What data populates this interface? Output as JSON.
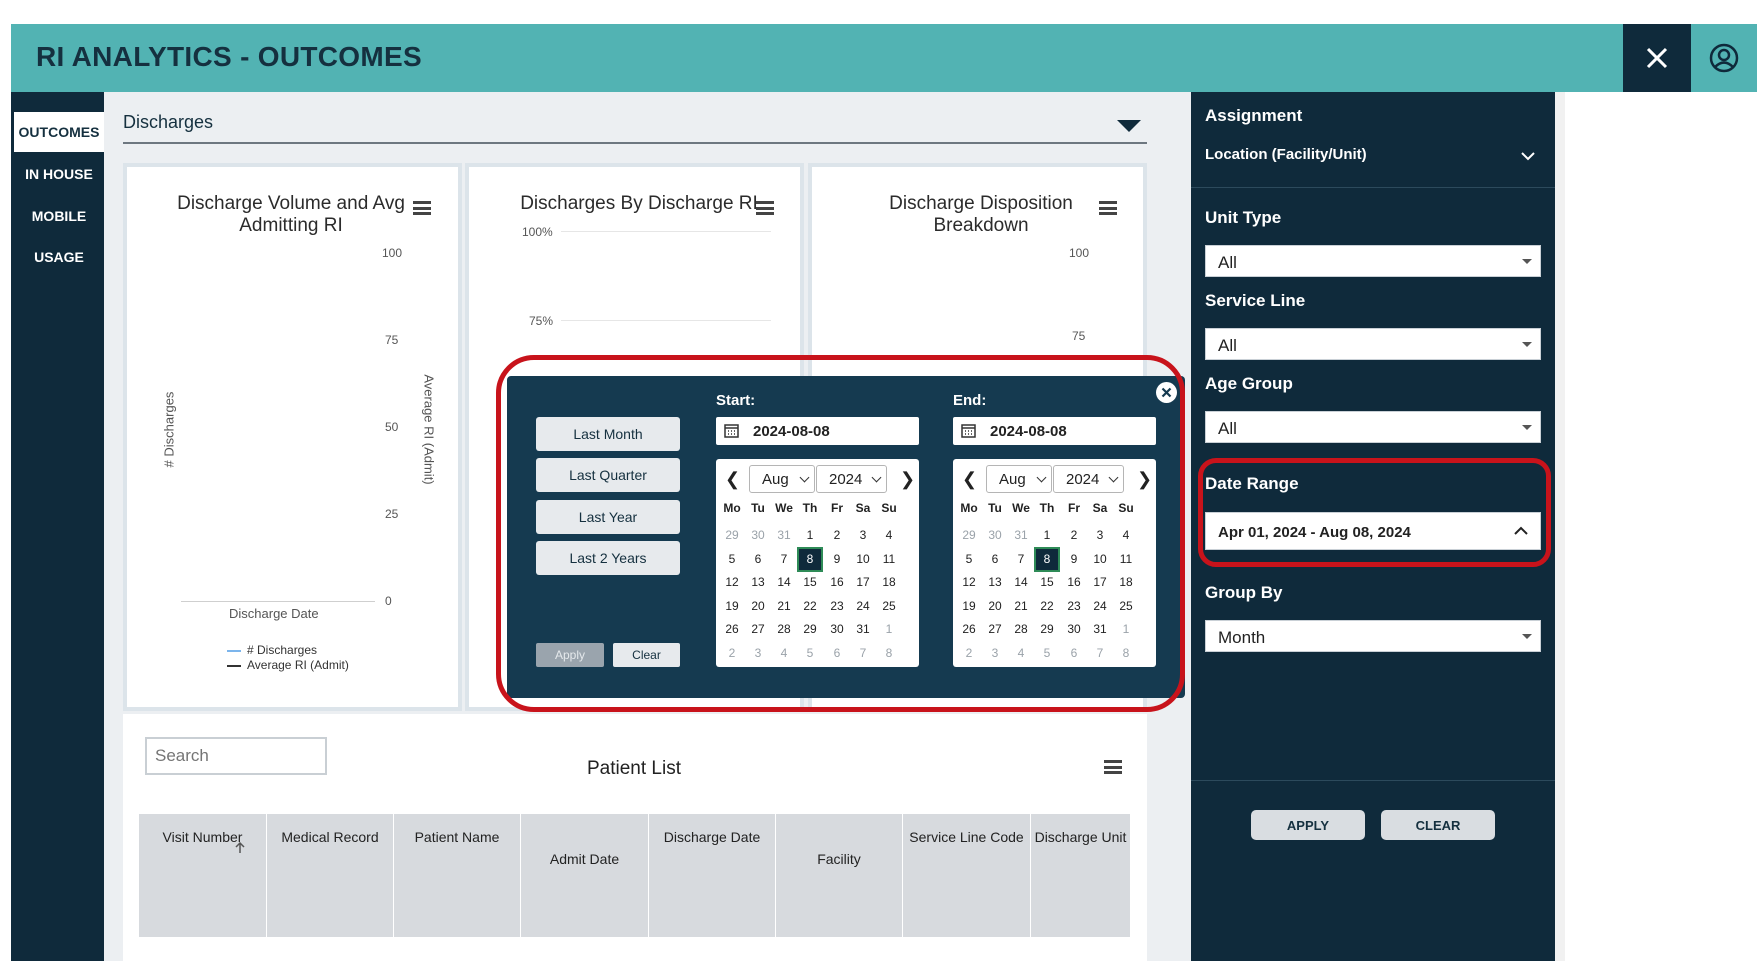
{
  "header": {
    "title": "RI ANALYTICS - OUTCOMES"
  },
  "nav": {
    "items": [
      "OUTCOMES",
      "IN HOUSE",
      "MOBILE",
      "USAGE"
    ]
  },
  "section": {
    "title": "Discharges"
  },
  "charts": {
    "volume": {
      "title_line1": "Discharge Volume and Avg",
      "title_line2": "Admitting RI",
      "yticks": [
        "100",
        "75",
        "50",
        "25",
        "0"
      ],
      "ylabel_left": "# Discharges",
      "ylabel_right": "Average RI (Admit)",
      "xlabel": "Discharge Date",
      "legend": [
        "# Discharges",
        "Average RI (Admit)"
      ]
    },
    "by_ri": {
      "title": "Discharges By Discharge RI",
      "yticks": [
        "100%",
        "75%"
      ]
    },
    "disposition": {
      "title_line1": "Discharge Disposition",
      "title_line2": "Breakdown",
      "yticks": [
        "100",
        "75"
      ]
    }
  },
  "date_picker": {
    "presets": [
      "Last Month",
      "Last Quarter",
      "Last Year",
      "Last 2 Years"
    ],
    "start_label": "Start:",
    "end_label": "End:",
    "start_value": "2024-08-08",
    "end_value": "2024-08-08",
    "start_month": "Aug",
    "start_year": "2024",
    "end_month": "Aug",
    "end_year": "2024",
    "weekdays": [
      "Mo",
      "Tu",
      "We",
      "Th",
      "Fr",
      "Sa",
      "Su"
    ],
    "days": [
      [
        "29",
        "30",
        "31",
        "1",
        "2",
        "3",
        "4"
      ],
      [
        "5",
        "6",
        "7",
        "8",
        "9",
        "10",
        "11"
      ],
      [
        "12",
        "13",
        "14",
        "15",
        "16",
        "17",
        "18"
      ],
      [
        "19",
        "20",
        "21",
        "22",
        "23",
        "24",
        "25"
      ],
      [
        "26",
        "27",
        "28",
        "29",
        "30",
        "31",
        "1"
      ],
      [
        "2",
        "3",
        "4",
        "5",
        "6",
        "7",
        "8"
      ]
    ],
    "selected_day": "8",
    "apply_label": "Apply",
    "clear_label": "Clear"
  },
  "filters": {
    "assignment_label": "Assignment",
    "location_label": "Location (Facility/Unit)",
    "unit_type_label": "Unit Type",
    "unit_type_value": "All",
    "service_line_label": "Service Line",
    "service_line_value": "All",
    "age_group_label": "Age Group",
    "age_group_value": "All",
    "date_range_label": "Date Range",
    "date_range_value": "Apr 01, 2024 - Aug 08, 2024",
    "group_by_label": "Group By",
    "group_by_value": "Month",
    "apply_label": "APPLY",
    "clear_label": "CLEAR"
  },
  "patient_list": {
    "search_placeholder": "Search",
    "title": "Patient List",
    "columns": [
      "Visit Number",
      "Medical Record",
      "Patient Name",
      "Admit Date",
      "Discharge Date",
      "Facility",
      "Service Line Code",
      "Discharge Unit"
    ]
  },
  "colors": {
    "header_bg": "#52b3b3",
    "navy": "#0f2a3b",
    "popup_bg": "#153a50",
    "highlight": "#c8131b"
  }
}
